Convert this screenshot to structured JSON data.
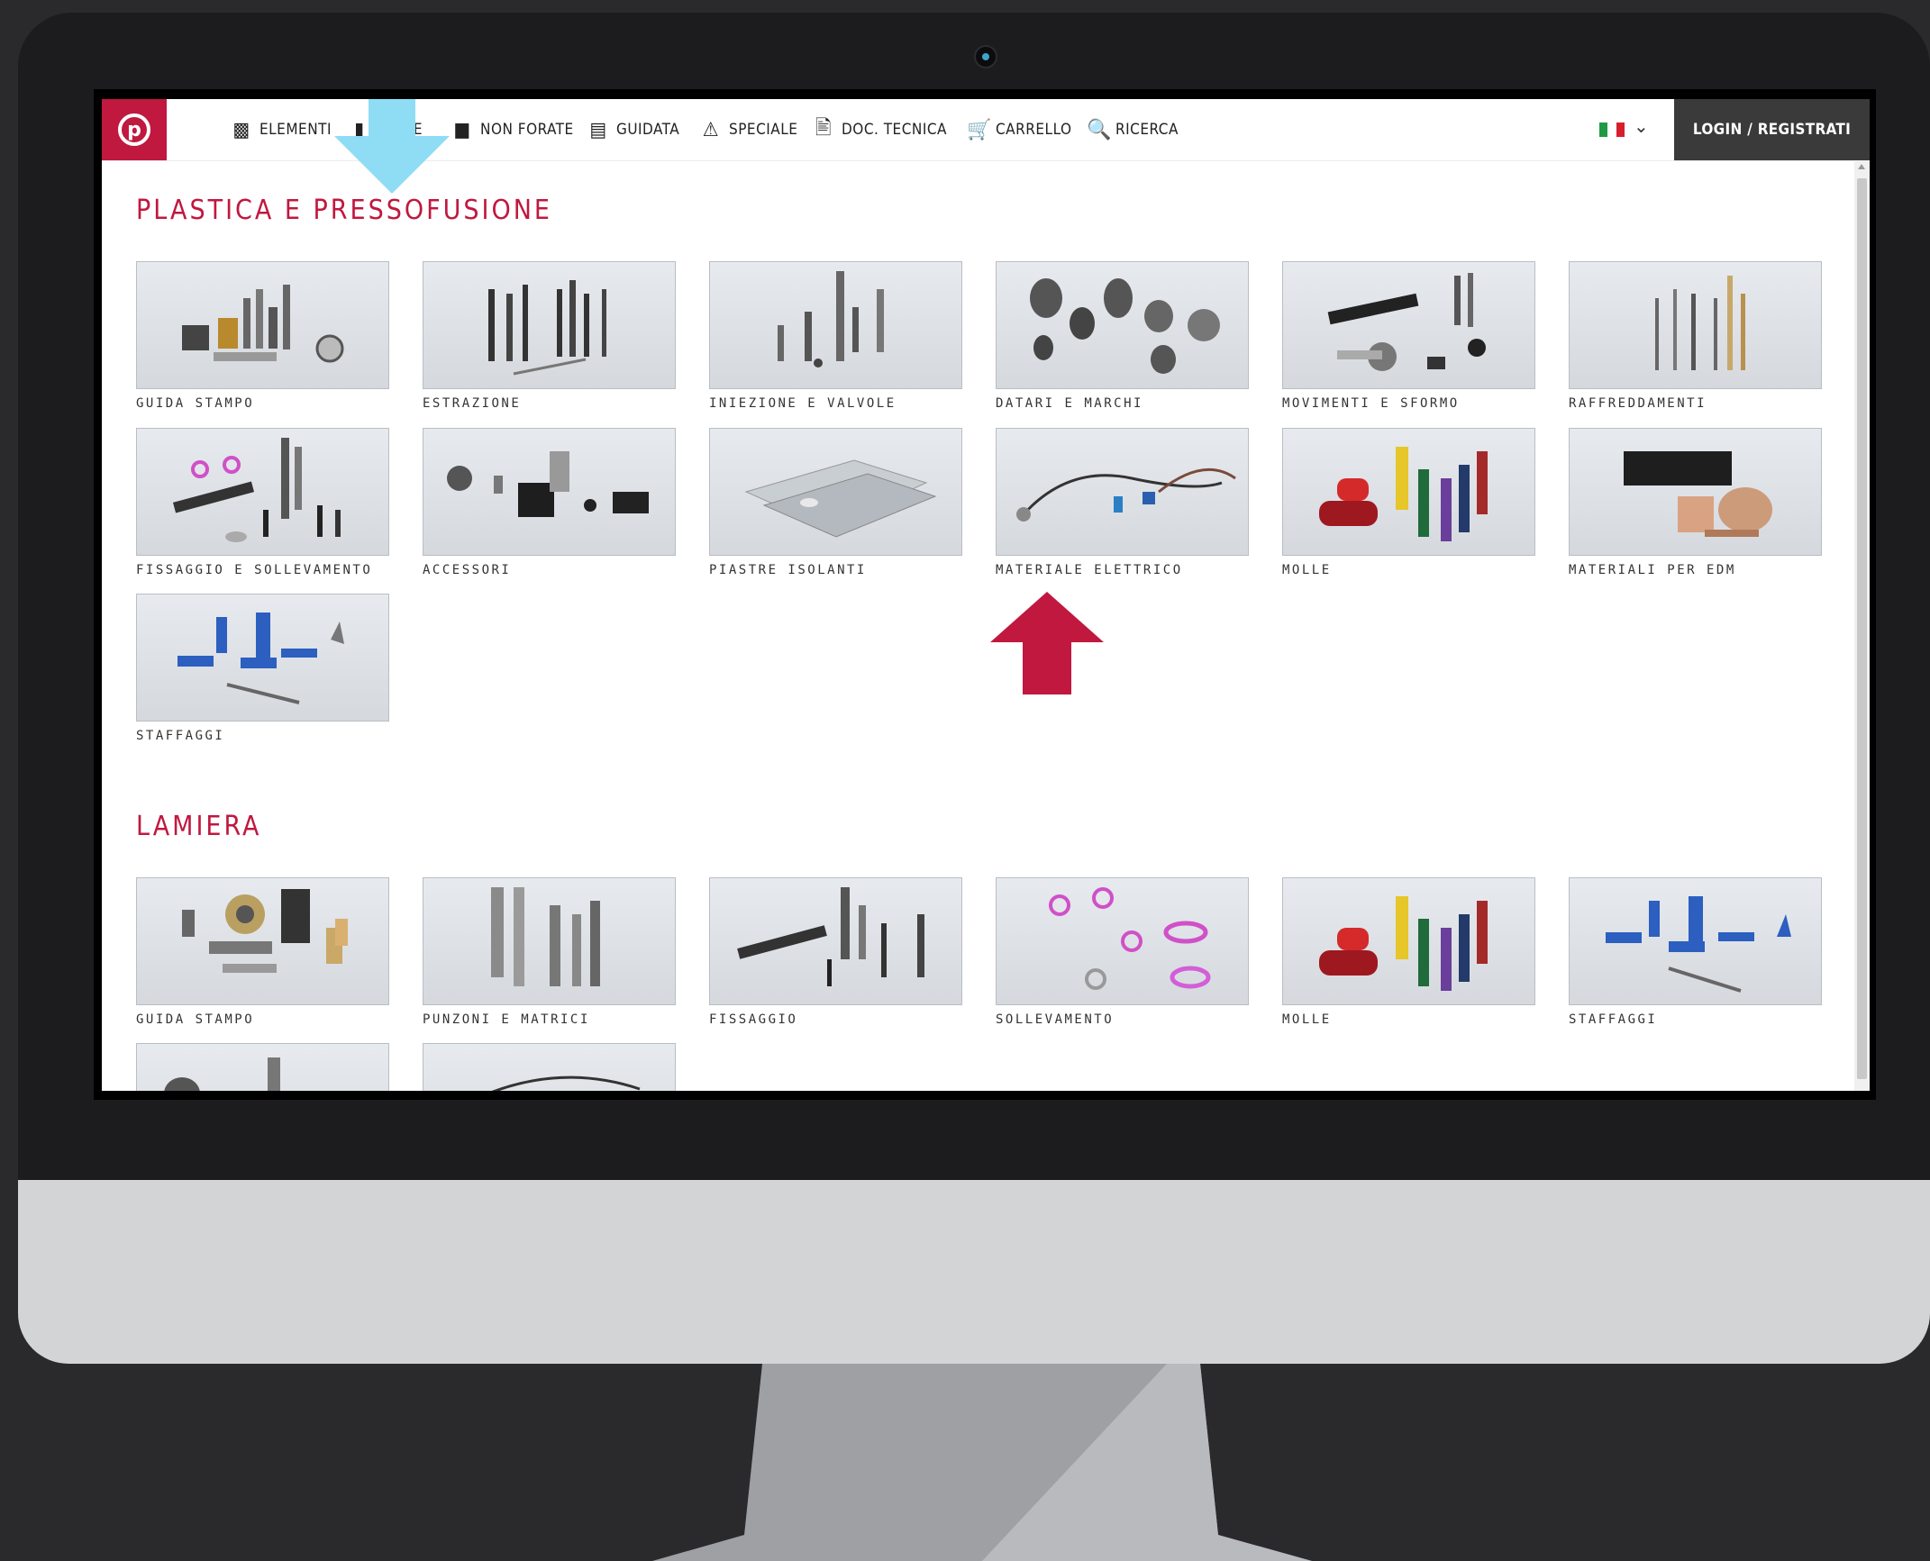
{
  "nav": {
    "items": [
      {
        "label": "ELEMENTI",
        "icon": "bar-chart-icon"
      },
      {
        "label": "TE",
        "icon": "plate-icon"
      },
      {
        "label": "NON FORATE",
        "icon": "square-icon"
      },
      {
        "label": "GUIDATA",
        "icon": "guide-icon"
      },
      {
        "label": "SPECIALE",
        "icon": "warning-triangle-icon"
      },
      {
        "label": "DOC. TECNICA",
        "icon": "document-icon"
      },
      {
        "label": "CARRELLO",
        "icon": "cart-icon"
      },
      {
        "label": "RICERCA",
        "icon": "search-icon"
      }
    ],
    "language": "IT",
    "login_label": "LOGIN / REGISTRATI"
  },
  "sections": [
    {
      "title": "PLASTICA E PRESSOFUSIONE",
      "tiles": [
        "GUIDA STAMPO",
        "ESTRAZIONE",
        "INIEZIONE E VALVOLE",
        "DATARI E MARCHI",
        "MOVIMENTI E SFORMO",
        "RAFFREDDAMENTI",
        "FISSAGGIO E SOLLEVAMENTO",
        "ACCESSORI",
        "PIASTRE ISOLANTI",
        "MATERIALE ELETTRICO",
        "MOLLE",
        "MATERIALI PER EDM",
        "STAFFAGGI"
      ]
    },
    {
      "title": "LAMIERA",
      "tiles": [
        "GUIDA STAMPO",
        "PUNZONI E MATRICI",
        "FISSAGGIO",
        "SOLLEVAMENTO",
        "MOLLE",
        "STAFFAGGI",
        "",
        ""
      ]
    }
  ],
  "colors": {
    "brand": "#c0183f",
    "login_bg": "#3a3a3a",
    "arrow_blue": "#8fdcf5",
    "arrow_red": "#c0183f",
    "flag_green": "#1e9a45",
    "flag_red": "#d61f2c"
  }
}
